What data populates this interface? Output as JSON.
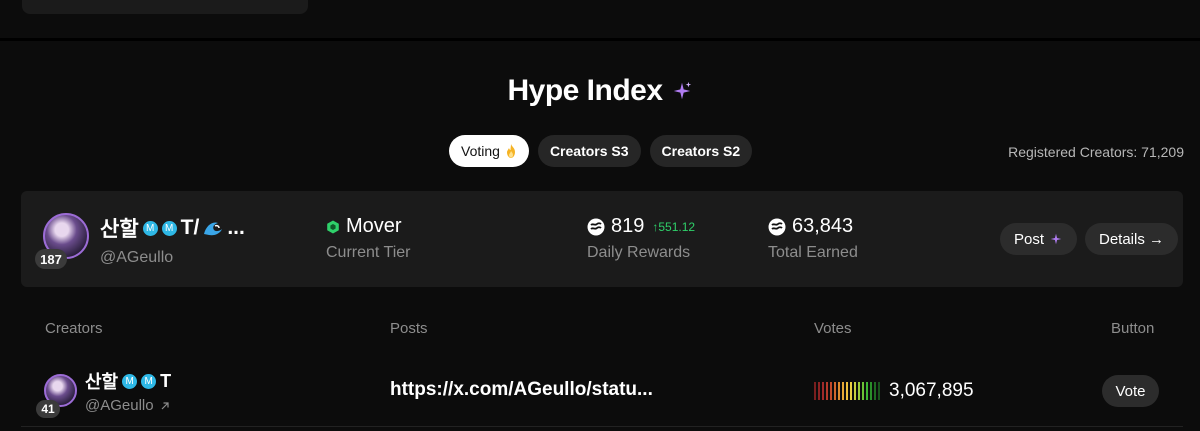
{
  "hype": {
    "title": "Hype Index"
  },
  "tabs": [
    {
      "label": "Voting",
      "active": true
    },
    {
      "label": "Creators S3",
      "active": false
    },
    {
      "label": "Creators S2",
      "active": false
    }
  ],
  "registered": "Registered Creators: 71,209",
  "featured": {
    "rank": "187",
    "name": "산할",
    "name_suffix": "T/",
    "name_tail": "...",
    "handle": "@AGeullo",
    "tier_value": "Mover",
    "tier_label": "Current Tier",
    "daily_value": "819",
    "daily_delta": "↑551.12",
    "daily_label": "Daily Rewards",
    "total_value": "63,843",
    "total_label": "Total Earned",
    "post_label": "Post",
    "details_label": "Details →"
  },
  "table": {
    "headers": [
      "Creators",
      "Posts",
      "Votes",
      "Button"
    ],
    "rows": [
      {
        "rank": "41",
        "name": "산할",
        "name_suffix": "T",
        "handle": "@AGeullo",
        "post": "https://x.com/AGeullo/statu...",
        "votes": "3,067,895",
        "button": "Vote"
      }
    ]
  },
  "badge_letter": "M",
  "colors": {
    "background": "#0c0c0c",
    "card": "#1b1b1b",
    "pill": "#2c2c2c",
    "accent_green": "#2fd06a",
    "accent_purple": "#b07cf2",
    "badge_blue": "#2eb8e6"
  },
  "icons": {
    "title": "sparkle-icon",
    "voting_tab": "fire-icon",
    "tier": "hexagon-icon",
    "rewards": "token-icon",
    "handle_link": "external-link-icon"
  }
}
